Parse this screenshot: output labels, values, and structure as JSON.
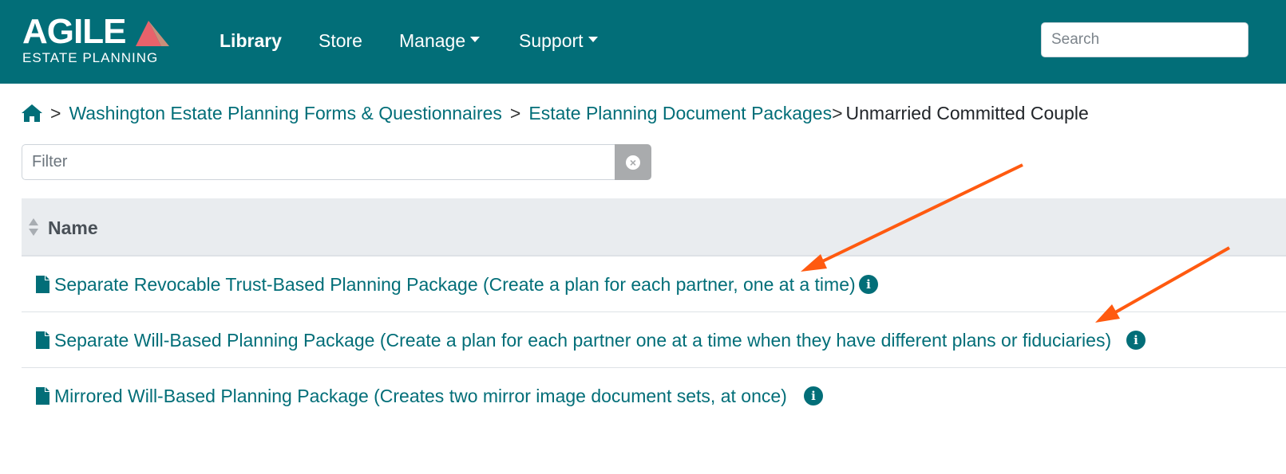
{
  "navbar": {
    "logo": {
      "main": "AGILE",
      "sub": "ESTATE PLANNING",
      "mark_color": "#e8626b"
    },
    "items": [
      {
        "label": "Library",
        "active": true,
        "dropdown": false
      },
      {
        "label": "Store",
        "active": false,
        "dropdown": false
      },
      {
        "label": "Manage",
        "active": false,
        "dropdown": true
      },
      {
        "label": "Support",
        "active": false,
        "dropdown": true
      }
    ],
    "search_placeholder": "Search",
    "background": "#026e78"
  },
  "breadcrumb": {
    "home_icon": "home-icon",
    "separator": ">",
    "links": [
      "Washington Estate Planning Forms & Questionnaires",
      "Estate Planning Document Packages"
    ],
    "current": "Unmarried Committed Couple"
  },
  "filter": {
    "placeholder": "Filter",
    "clear_icon": "clear-icon"
  },
  "table": {
    "header": "Name",
    "rows": [
      {
        "label": "Separate Revocable Trust-Based Planning Package (Create a plan for each partner, one at a time)",
        "icon": "file-icon",
        "info_icon": "info-icon"
      },
      {
        "label": "Separate Will-Based Planning Package (Create a plan for each partner one at a time when they have different plans or fiduciaries)",
        "icon": "file-icon",
        "info_icon": "info-icon"
      },
      {
        "label": "Mirrored Will-Based Planning Package (Creates two mirror image document sets, at once)",
        "icon": "file-icon",
        "info_icon": "info-icon"
      }
    ]
  },
  "annotations": {
    "arrow_color": "#ff5a10",
    "arrow_count": 2
  }
}
